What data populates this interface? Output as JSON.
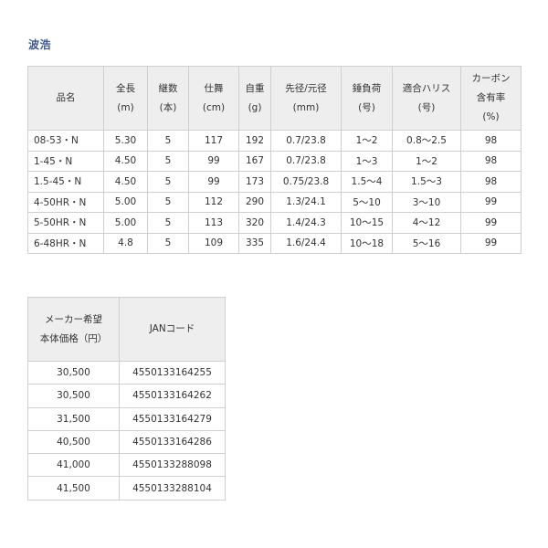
{
  "title": "波浩",
  "spec_table": {
    "headers": [
      [
        "品名"
      ],
      [
        "全長",
        "(m)"
      ],
      [
        "継数",
        "(本)"
      ],
      [
        "仕舞",
        "(cm)"
      ],
      [
        "自重",
        "(g)"
      ],
      [
        "先径/元径",
        "(mm)"
      ],
      [
        "錘負荷",
        "(号)"
      ],
      [
        "適合ハリス",
        "(号)"
      ],
      [
        "カーボン",
        "含有率",
        "(%)"
      ]
    ],
    "rows": [
      [
        "08-53・N",
        "5.30",
        "5",
        "117",
        "192",
        "0.7/23.8",
        "1〜2",
        "0.8〜2.5",
        "98"
      ],
      [
        "1-45・N",
        "4.50",
        "5",
        "99",
        "167",
        "0.7/23.8",
        "1〜3",
        "1〜2",
        "98"
      ],
      [
        "1.5-45・N",
        "4.50",
        "5",
        "99",
        "173",
        "0.75/23.8",
        "1.5〜4",
        "1.5〜3",
        "98"
      ],
      [
        "4-50HR・N",
        "5.00",
        "5",
        "112",
        "290",
        "1.3/24.1",
        "5〜10",
        "3〜10",
        "99"
      ],
      [
        "5-50HR・N",
        "5.00",
        "5",
        "113",
        "320",
        "1.4/24.3",
        "10〜15",
        "4〜12",
        "99"
      ],
      [
        "6-48HR・N",
        "4.8",
        "5",
        "109",
        "335",
        "1.6/24.4",
        "10〜18",
        "5〜16",
        "99"
      ]
    ]
  },
  "price_table": {
    "headers": [
      [
        "メーカー希望",
        "本体価格（円）"
      ],
      [
        "JANコード"
      ]
    ],
    "rows": [
      [
        "30,500",
        "4550133164255"
      ],
      [
        "30,500",
        "4550133164262"
      ],
      [
        "31,500",
        "4550133164279"
      ],
      [
        "40,500",
        "4550133164286"
      ],
      [
        "41,000",
        "4550133288098"
      ],
      [
        "41,500",
        "4550133288104"
      ]
    ]
  }
}
